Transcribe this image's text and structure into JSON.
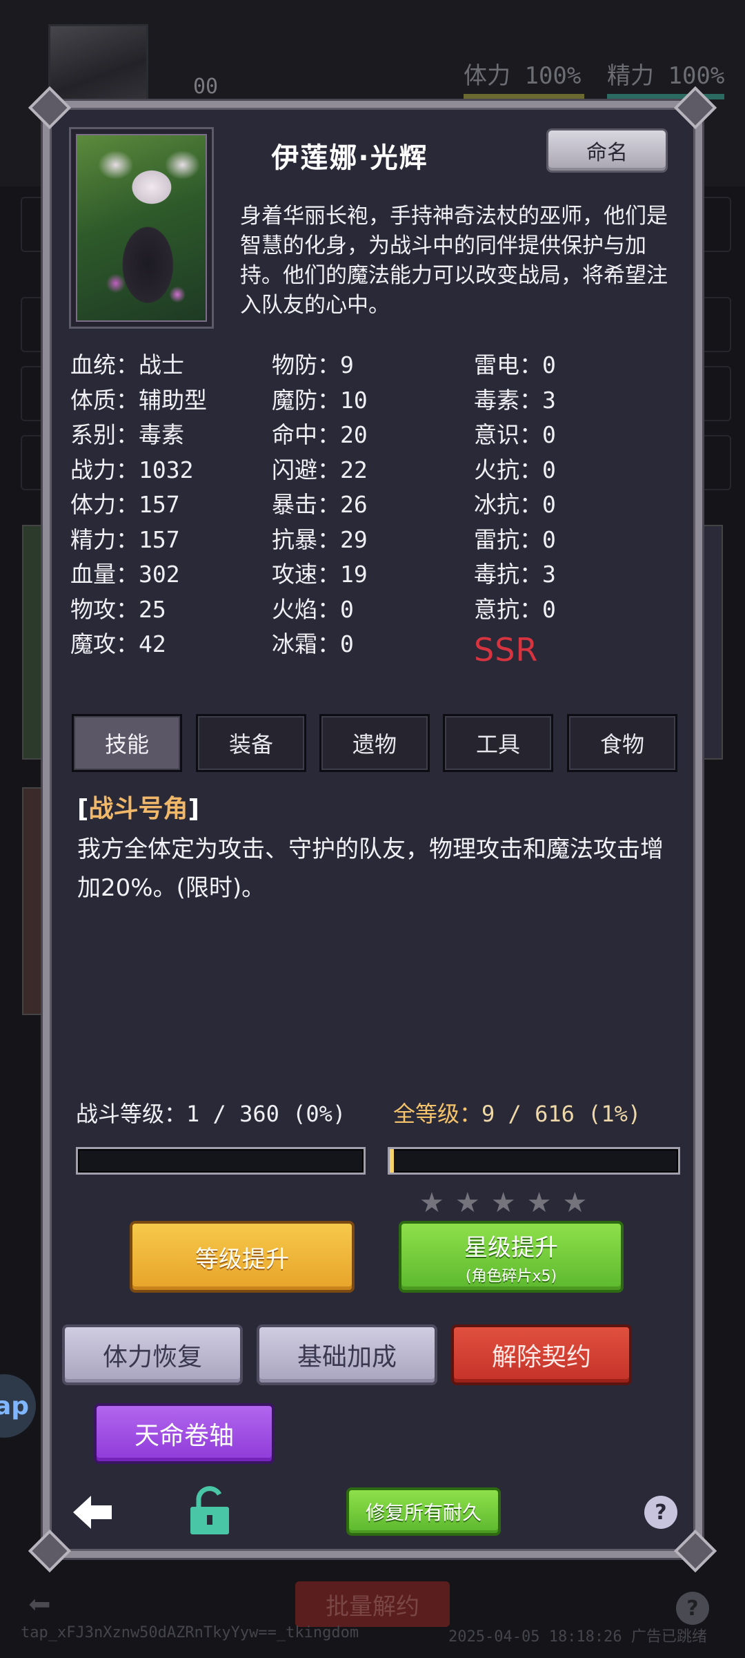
{
  "background": {
    "level_text": "00",
    "stamina_label": "体力 100%",
    "energy_label": "精力 100%",
    "ap_badge": "ap",
    "batch_release_label": "批量解约",
    "help_symbol": "?",
    "footer_id": "tap_xFJ3nXznw50dAZRnTkyYyw==_tkingdom",
    "footer_status": "2025-04-05 18:18:26 广告已跳绪"
  },
  "character": {
    "name": "伊莲娜·光辉",
    "rename_label": "命名",
    "description": "身着华丽长袍，手持神奇法杖的巫师，他们是智慧的化身，为战斗中的同伴提供保护与加持。他们的魔法能力可以改变战局，将希望注入队友的心中。",
    "rarity": "SSR"
  },
  "stats": {
    "col1": [
      {
        "k": "血统：",
        "v": "战士"
      },
      {
        "k": "体质：",
        "v": "辅助型"
      },
      {
        "k": "系别：",
        "v": "毒素"
      },
      {
        "k": "战力：",
        "v": "1032"
      },
      {
        "k": "体力：",
        "v": "157"
      },
      {
        "k": "精力：",
        "v": "157"
      },
      {
        "k": "血量：",
        "v": "302"
      },
      {
        "k": "物攻：",
        "v": "25"
      },
      {
        "k": "魔攻：",
        "v": "42"
      }
    ],
    "col2": [
      {
        "k": "物防：",
        "v": "9"
      },
      {
        "k": "魔防：",
        "v": "10"
      },
      {
        "k": "命中：",
        "v": "20"
      },
      {
        "k": "闪避：",
        "v": "22"
      },
      {
        "k": "暴击：",
        "v": "26"
      },
      {
        "k": "抗暴：",
        "v": "29"
      },
      {
        "k": "攻速：",
        "v": "19"
      },
      {
        "k": "火焰：",
        "v": "0"
      },
      {
        "k": "冰霜：",
        "v": "0"
      }
    ],
    "col3": [
      {
        "k": "雷电：",
        "v": "0"
      },
      {
        "k": "毒素：",
        "v": "3"
      },
      {
        "k": "意识：",
        "v": "0"
      },
      {
        "k": "火抗：",
        "v": "0"
      },
      {
        "k": "冰抗：",
        "v": "0"
      },
      {
        "k": "雷抗：",
        "v": "0"
      },
      {
        "k": "毒抗：",
        "v": "3"
      },
      {
        "k": "意抗：",
        "v": "0"
      }
    ]
  },
  "tabs": [
    {
      "label": "技能",
      "active": true
    },
    {
      "label": "装备",
      "active": false
    },
    {
      "label": "遗物",
      "active": false
    },
    {
      "label": "工具",
      "active": false
    },
    {
      "label": "食物",
      "active": false
    }
  ],
  "skill": {
    "bracket_open": "[",
    "name": "战斗号角",
    "bracket_close": "]",
    "description": "我方全体定为攻击、守护的队友，物理攻击和魔法攻击增加20%。(限时)。"
  },
  "levels": {
    "battle_label": "战斗等级：",
    "battle_value": "1 / 360 (0%)",
    "battle_progress": 0,
    "total_label": "全等级：",
    "total_value": "9 / 616 (1%)",
    "total_progress": 0.015
  },
  "stars": {
    "filled": 0,
    "total": 5,
    "symbol": "★"
  },
  "buttons": {
    "level_up": "等级提升",
    "star_up": "星级提升",
    "star_up_sub": "(角色碎片x5)",
    "stamina_restore": "体力恢复",
    "base_bonus": "基础加成",
    "release_contract": "解除契约",
    "fate_scroll": "天命卷轴",
    "repair_all": "修复所有耐久",
    "help": "?"
  },
  "colors": {
    "skill_name": "#f1b86a",
    "rarity": "#d8343f",
    "total_level": "#f5c36a",
    "lock_icon": "#48c6a6"
  },
  "icons": {
    "back": "back-arrow-icon",
    "lock": "unlock-icon",
    "help": "help-icon",
    "star": "star-icon"
  }
}
